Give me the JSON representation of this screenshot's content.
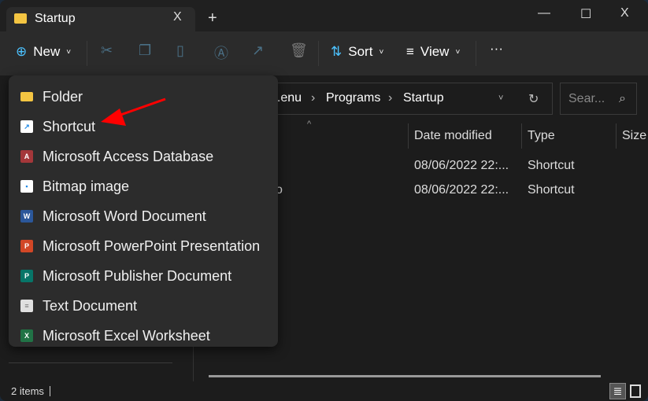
{
  "window": {
    "tab_title": "Startup",
    "close_tab": "X",
    "new_tab": "+",
    "minimize": "—",
    "maximize": "☐",
    "close": "X"
  },
  "toolbar": {
    "new_label": "New",
    "sort_label": "Sort",
    "view_label": "View",
    "more": "···"
  },
  "address": {
    "path": [
      "...enu",
      "Programs",
      "Startup"
    ],
    "search_placeholder": "Sear..."
  },
  "columns": [
    "Date modified",
    "Type",
    "Size"
  ],
  "rows": [
    {
      "name_fragment": "",
      "date": "08/06/2022 22:...",
      "type": "Shortcut"
    },
    {
      "name_fragment": "o",
      "date": "08/06/2022 22:...",
      "type": "Shortcut"
    }
  ],
  "menu": {
    "items": [
      {
        "label": "Folder",
        "icon": "folder-icon",
        "color": "#f4c542",
        "glyph": ""
      },
      {
        "label": "Shortcut",
        "icon": "shortcut-icon",
        "color": "#ffffff",
        "glyph": "↗"
      },
      {
        "label": "Microsoft Access Database",
        "icon": "access-icon",
        "color": "#a4373a",
        "glyph": "A"
      },
      {
        "label": "Bitmap image",
        "icon": "bitmap-icon",
        "color": "#ffffff",
        "glyph": "▪"
      },
      {
        "label": "Microsoft Word Document",
        "icon": "word-icon",
        "color": "#2b579a",
        "glyph": "W"
      },
      {
        "label": "Microsoft PowerPoint Presentation",
        "icon": "powerpoint-icon",
        "color": "#d24726",
        "glyph": "P"
      },
      {
        "label": "Microsoft Publisher Document",
        "icon": "publisher-icon",
        "color": "#077568",
        "glyph": "P"
      },
      {
        "label": "Text Document",
        "icon": "text-document-icon",
        "color": "#e0e0e0",
        "glyph": "≡"
      },
      {
        "label": "Microsoft Excel Worksheet",
        "icon": "excel-icon",
        "color": "#217346",
        "glyph": "X"
      }
    ]
  },
  "status": {
    "items_count": "2 items"
  },
  "colors": {
    "accent": "#4cc2ff",
    "annotation_arrow": "#ff0000"
  }
}
